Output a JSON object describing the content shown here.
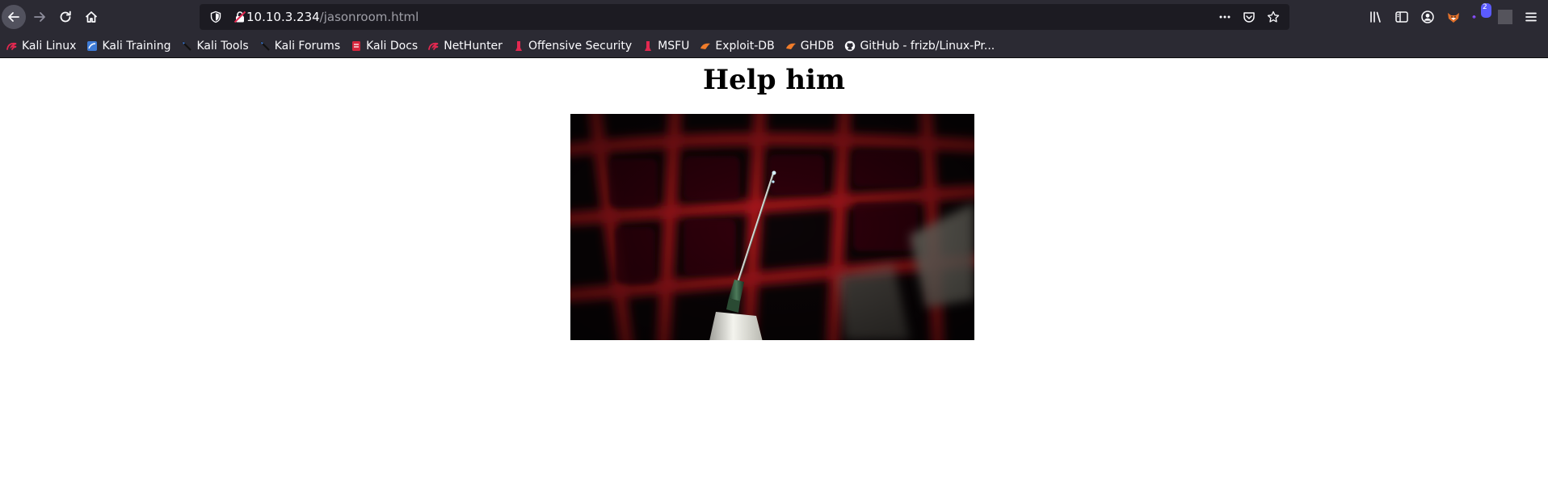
{
  "browser": {
    "url": {
      "host": "10.10.3.234",
      "path": "/jasonroom.html"
    },
    "toolbar_icons": [
      "back-icon",
      "forward-icon",
      "reload-icon",
      "home-icon"
    ],
    "url_icons": [
      "shield-icon",
      "insecure-lock-icon",
      "more-icon",
      "pocket-icon",
      "bookmark-star-icon"
    ],
    "right_icons": [
      "library-icon",
      "sidebar-icon",
      "account-icon",
      "fox-extension-icon",
      "extension-icon",
      "menu-icon"
    ],
    "extension_badge": "2",
    "colors": {
      "chrome_bg": "#2b2a33",
      "url_bg": "#1c1b22",
      "text": "#fbfbfe",
      "dim_text": "#9e9ea6"
    }
  },
  "bookmarks": [
    {
      "label": "Kali Linux",
      "icon": "kali-dragon-icon"
    },
    {
      "label": "Kali Training",
      "icon": "kali-training-icon"
    },
    {
      "label": "Kali Tools",
      "icon": "kali-tools-icon"
    },
    {
      "label": "Kali Forums",
      "icon": "kali-forums-icon"
    },
    {
      "label": "Kali Docs",
      "icon": "kali-docs-icon"
    },
    {
      "label": "NetHunter",
      "icon": "nethunter-icon"
    },
    {
      "label": "Offensive Security",
      "icon": "offsec-icon"
    },
    {
      "label": "MSFU",
      "icon": "msfu-icon"
    },
    {
      "label": "Exploit-DB",
      "icon": "exploitdb-icon"
    },
    {
      "label": "GHDB",
      "icon": "ghdb-icon"
    },
    {
      "label": "GitHub - frizb/Linux-Pr...",
      "icon": "github-icon"
    }
  ],
  "page": {
    "heading": "Help him",
    "image_subject": "syringe-over-red-bars-illustration"
  }
}
